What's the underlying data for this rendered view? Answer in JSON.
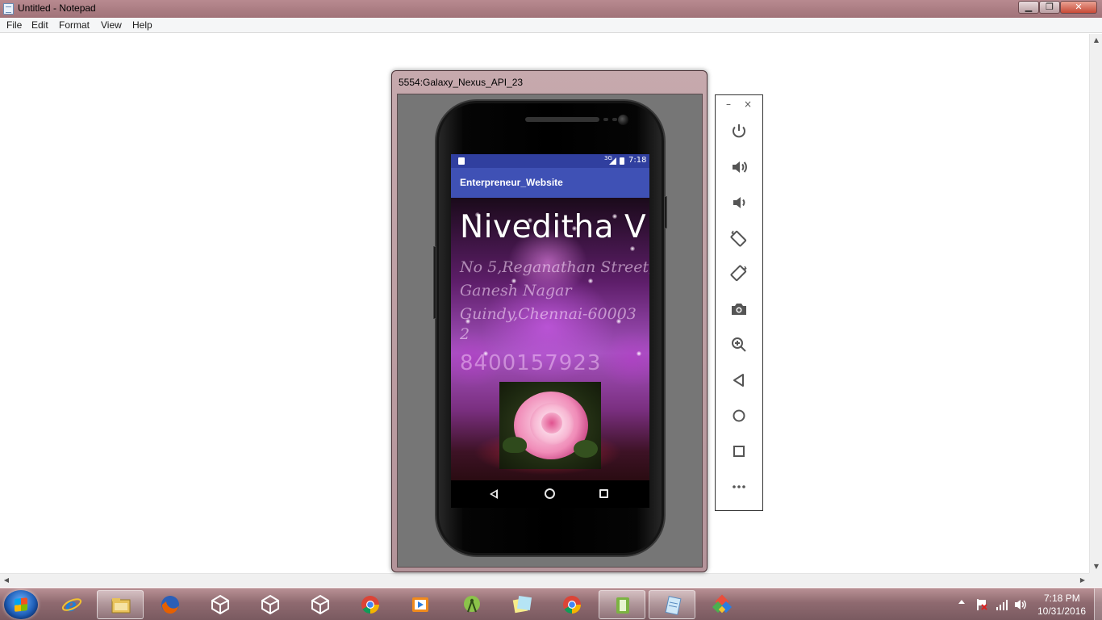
{
  "notepad": {
    "title": "Untitled - Notepad",
    "menu": [
      "File",
      "Edit",
      "Format",
      "View",
      "Help"
    ],
    "controls": {
      "minimize": "▁",
      "maximize": "❐",
      "close": "✕"
    }
  },
  "emulator": {
    "window_title": "5554:Galaxy_Nexus_API_23",
    "status_bar": {
      "network": "3G",
      "time": "7:18"
    },
    "app_title": "Enterpreneur_Website",
    "content": {
      "name": "Niveditha V",
      "address_lines": [
        "No 5,Reganathan Street,",
        "Ganesh Nagar",
        "Guindy,Chennai-60003",
        "2"
      ],
      "phone": "8400157923"
    },
    "nav_buttons": [
      "back",
      "home",
      "recents"
    ]
  },
  "toolbar": {
    "minimize": "–",
    "close": "×",
    "buttons": [
      {
        "name": "power-icon"
      },
      {
        "name": "volume-up-icon"
      },
      {
        "name": "volume-down-icon"
      },
      {
        "name": "rotate-left-icon"
      },
      {
        "name": "rotate-right-icon"
      },
      {
        "name": "camera-icon"
      },
      {
        "name": "zoom-icon"
      },
      {
        "name": "back-icon"
      },
      {
        "name": "home-icon"
      },
      {
        "name": "overview-icon"
      },
      {
        "name": "more-icon"
      }
    ]
  },
  "taskbar": {
    "apps": [
      {
        "name": "file-explorer-icon"
      },
      {
        "name": "internet-explorer-icon"
      },
      {
        "name": "firefox-icon"
      },
      {
        "name": "unity-icon"
      },
      {
        "name": "unity-icon"
      },
      {
        "name": "unity-icon"
      },
      {
        "name": "chrome-icon"
      },
      {
        "name": "media-player-icon"
      },
      {
        "name": "android-studio-icon"
      },
      {
        "name": "sticky-notes-icon"
      },
      {
        "name": "chrome-icon"
      },
      {
        "name": "android-emulator-icon"
      },
      {
        "name": "notepad-icon"
      },
      {
        "name": "tool-icon"
      }
    ],
    "clock": {
      "time": "7:18 PM",
      "date": "10/31/2016"
    }
  }
}
